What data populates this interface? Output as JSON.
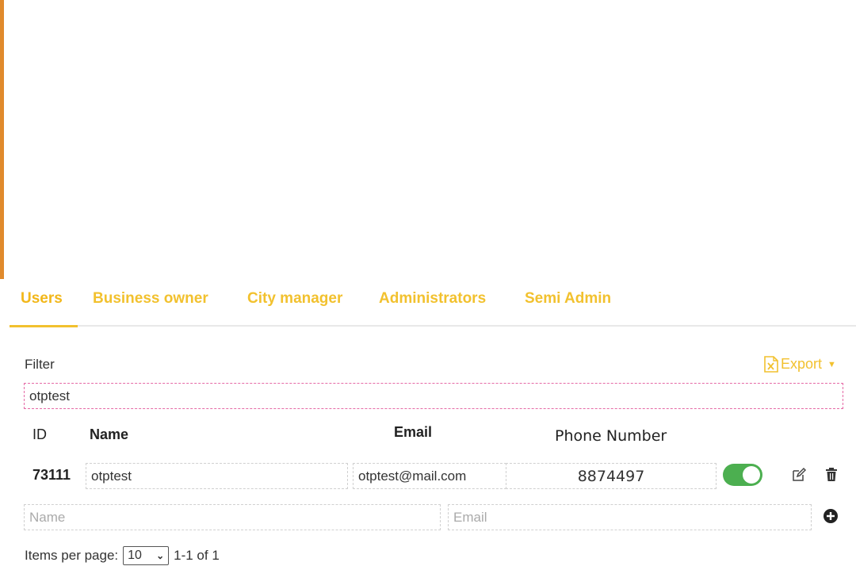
{
  "tabs": [
    {
      "label": "Users",
      "active": true
    },
    {
      "label": "Business owner",
      "active": false
    },
    {
      "label": "City manager",
      "active": false
    },
    {
      "label": "Administrators",
      "active": false
    },
    {
      "label": "Semi Admin",
      "active": false
    }
  ],
  "filter": {
    "label": "Filter",
    "value": "otptest"
  },
  "export": {
    "label": "Export",
    "icon": "excel-file-icon"
  },
  "table": {
    "headers": {
      "id": "ID",
      "name": "Name",
      "email": "Email",
      "phone": "Phone Number"
    },
    "rows": [
      {
        "id": "73111",
        "name": "otptest",
        "email": "otptest@mail.com",
        "phone": "8874497",
        "enabled": true
      }
    ]
  },
  "new_row": {
    "name_placeholder": "Name",
    "email_placeholder": "Email"
  },
  "pagination": {
    "items_per_page_label": "Items per page:",
    "page_size": "10",
    "range": "1-1 of 1"
  },
  "colors": {
    "accent": "#f2c12e",
    "toggle_on": "#4caf50",
    "sidebar_edge": "#e08a2c",
    "filter_border": "#e56aa6"
  }
}
